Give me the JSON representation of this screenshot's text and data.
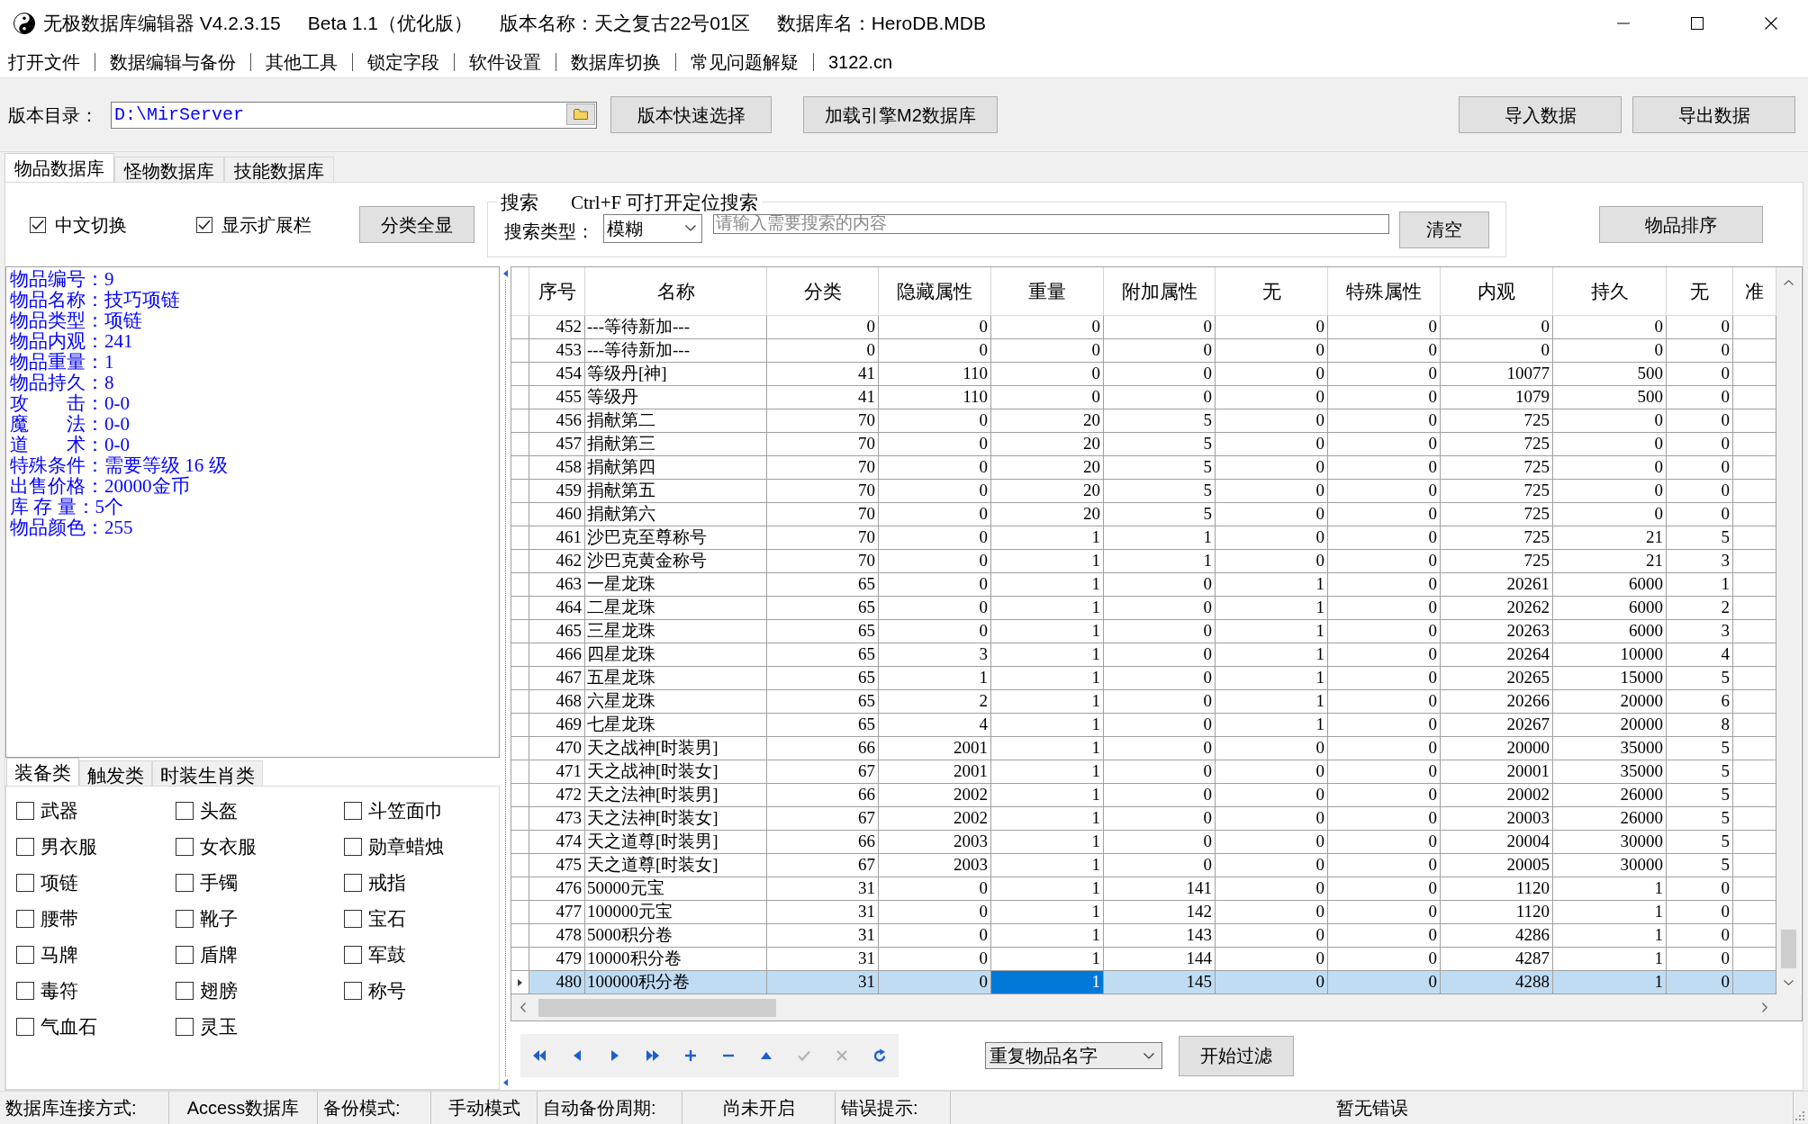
{
  "window": {
    "title_parts": [
      "无极数据库编辑器 V4.2.3.15",
      "Beta 1.1（优化版）",
      "版本名称：天之复古22号01区",
      "数据库名：HeroDB.MDB"
    ]
  },
  "menu": [
    "打开文件",
    "数据编辑与备份",
    "其他工具",
    "锁定字段",
    "软件设置",
    "数据库切换",
    "常见问题解疑",
    "3122.cn"
  ],
  "toolbar": {
    "path_label": "版本目录：",
    "path_value": "D:\\MirServer",
    "buttons": [
      "版本快速选择",
      "加载引擎M2数据库"
    ],
    "data_buttons": [
      "导入数据",
      "导出数据"
    ]
  },
  "tabs": [
    {
      "label": "物品数据库",
      "selected": true
    },
    {
      "label": "怪物数据库",
      "selected": false
    },
    {
      "label": "技能数据库",
      "selected": false
    }
  ],
  "options": {
    "checkboxes": [
      {
        "label": "中文切换",
        "checked": true
      },
      {
        "label": "显示扩展栏",
        "checked": true
      }
    ],
    "show_all_button": "分类全显"
  },
  "search": {
    "title": "搜索",
    "hint": "Ctrl+F 可打开定位搜索",
    "type_label": "搜索类型：",
    "type_value": "模糊",
    "placeholder": "请输入需要搜索的内容",
    "clear_button": "清空"
  },
  "sort_button": "物品排序",
  "item_info": [
    "物品编号：9",
    "物品名称：技巧项链",
    "物品类型：项链",
    "物品内观：241",
    "物品重量：1",
    "物品持久：8",
    "攻　　击：0-0",
    "魔　　法：0-0",
    "道　　术：0-0",
    "特殊条件：需要等级 16 级",
    "出售价格：20000金币",
    "库 存 量：5个",
    "物品颜色：255"
  ],
  "category_tabs": [
    {
      "label": "装备类",
      "selected": true
    },
    {
      "label": "触发类",
      "selected": false
    },
    {
      "label": "时装生肖类",
      "selected": false
    }
  ],
  "categories": [
    {
      "label": "武器",
      "checked": false
    },
    {
      "label": "头盔",
      "checked": false
    },
    {
      "label": "斗笠面巾",
      "checked": false
    },
    {
      "label": "男衣服",
      "checked": false
    },
    {
      "label": "女衣服",
      "checked": false
    },
    {
      "label": "勋章蜡烛",
      "checked": false
    },
    {
      "label": "项链",
      "checked": false
    },
    {
      "label": "手镯",
      "checked": false
    },
    {
      "label": "戒指",
      "checked": false
    },
    {
      "label": "腰带",
      "checked": false
    },
    {
      "label": "靴子",
      "checked": false
    },
    {
      "label": "宝石",
      "checked": false
    },
    {
      "label": "马牌",
      "checked": false
    },
    {
      "label": "盾牌",
      "checked": false
    },
    {
      "label": "军鼓",
      "checked": false
    },
    {
      "label": "毒符",
      "checked": false
    },
    {
      "label": "翅膀",
      "checked": false
    },
    {
      "label": "称号",
      "checked": false
    },
    {
      "label": "气血石",
      "checked": false
    },
    {
      "label": "灵玉",
      "checked": false
    }
  ],
  "table": {
    "columns": [
      {
        "label": "序号",
        "kind": "number",
        "focused": false
      },
      {
        "label": "名称",
        "kind": "text",
        "focused": false
      },
      {
        "label": "分类",
        "kind": "number",
        "focused": false
      },
      {
        "label": "隐藏属性",
        "kind": "number",
        "focused": false
      },
      {
        "label": "重量",
        "kind": "number",
        "focused": true
      },
      {
        "label": "附加属性",
        "kind": "number",
        "focused": false
      },
      {
        "label": "无",
        "kind": "number",
        "focused": false
      },
      {
        "label": "特殊属性",
        "kind": "number",
        "focused": false
      },
      {
        "label": "内观",
        "kind": "number",
        "focused": false
      },
      {
        "label": "持久",
        "kind": "number",
        "focused": false
      },
      {
        "label": "无",
        "kind": "number",
        "focused": false
      },
      {
        "label": "准",
        "kind": "number",
        "focused": false
      }
    ],
    "rows": [
      {
        "cells": [
          "452",
          "---等待新加---",
          "0",
          "0",
          "0",
          "0",
          "0",
          "0",
          "0",
          "0",
          "0"
        ],
        "selected": false
      },
      {
        "cells": [
          "453",
          "---等待新加---",
          "0",
          "0",
          "0",
          "0",
          "0",
          "0",
          "0",
          "0",
          "0"
        ],
        "selected": false
      },
      {
        "cells": [
          "454",
          "等级丹[神]",
          "41",
          "110",
          "0",
          "0",
          "0",
          "0",
          "10077",
          "500",
          "0"
        ],
        "selected": false
      },
      {
        "cells": [
          "455",
          "等级丹",
          "41",
          "110",
          "0",
          "0",
          "0",
          "0",
          "1079",
          "500",
          "0"
        ],
        "selected": false
      },
      {
        "cells": [
          "456",
          "捐献第二",
          "70",
          "0",
          "20",
          "5",
          "0",
          "0",
          "725",
          "0",
          "0"
        ],
        "selected": false
      },
      {
        "cells": [
          "457",
          "捐献第三",
          "70",
          "0",
          "20",
          "5",
          "0",
          "0",
          "725",
          "0",
          "0"
        ],
        "selected": false
      },
      {
        "cells": [
          "458",
          "捐献第四",
          "70",
          "0",
          "20",
          "5",
          "0",
          "0",
          "725",
          "0",
          "0"
        ],
        "selected": false
      },
      {
        "cells": [
          "459",
          "捐献第五",
          "70",
          "0",
          "20",
          "5",
          "0",
          "0",
          "725",
          "0",
          "0"
        ],
        "selected": false
      },
      {
        "cells": [
          "460",
          "捐献第六",
          "70",
          "0",
          "20",
          "5",
          "0",
          "0",
          "725",
          "0",
          "0"
        ],
        "selected": false
      },
      {
        "cells": [
          "461",
          "沙巴克至尊称号",
          "70",
          "0",
          "1",
          "1",
          "0",
          "0",
          "725",
          "21",
          "5"
        ],
        "selected": false
      },
      {
        "cells": [
          "462",
          "沙巴克黄金称号",
          "70",
          "0",
          "1",
          "1",
          "0",
          "0",
          "725",
          "21",
          "3"
        ],
        "selected": false
      },
      {
        "cells": [
          "463",
          "一星龙珠",
          "65",
          "0",
          "1",
          "0",
          "1",
          "0",
          "20261",
          "6000",
          "1"
        ],
        "selected": false
      },
      {
        "cells": [
          "464",
          "二星龙珠",
          "65",
          "0",
          "1",
          "0",
          "1",
          "0",
          "20262",
          "6000",
          "2"
        ],
        "selected": false
      },
      {
        "cells": [
          "465",
          "三星龙珠",
          "65",
          "0",
          "1",
          "0",
          "1",
          "0",
          "20263",
          "6000",
          "3"
        ],
        "selected": false
      },
      {
        "cells": [
          "466",
          "四星龙珠",
          "65",
          "3",
          "1",
          "0",
          "1",
          "0",
          "20264",
          "10000",
          "4"
        ],
        "selected": false
      },
      {
        "cells": [
          "467",
          "五星龙珠",
          "65",
          "1",
          "1",
          "0",
          "1",
          "0",
          "20265",
          "15000",
          "5"
        ],
        "selected": false
      },
      {
        "cells": [
          "468",
          "六星龙珠",
          "65",
          "2",
          "1",
          "0",
          "1",
          "0",
          "20266",
          "20000",
          "6"
        ],
        "selected": false
      },
      {
        "cells": [
          "469",
          "七星龙珠",
          "65",
          "4",
          "1",
          "0",
          "1",
          "0",
          "20267",
          "20000",
          "8"
        ],
        "selected": false
      },
      {
        "cells": [
          "470",
          "天之战神[时装男]",
          "66",
          "2001",
          "1",
          "0",
          "0",
          "0",
          "20000",
          "35000",
          "5"
        ],
        "selected": false
      },
      {
        "cells": [
          "471",
          "天之战神[时装女]",
          "67",
          "2001",
          "1",
          "0",
          "0",
          "0",
          "20001",
          "35000",
          "5"
        ],
        "selected": false
      },
      {
        "cells": [
          "472",
          "天之法神[时装男]",
          "66",
          "2002",
          "1",
          "0",
          "0",
          "0",
          "20002",
          "26000",
          "5"
        ],
        "selected": false
      },
      {
        "cells": [
          "473",
          "天之法神[时装女]",
          "67",
          "2002",
          "1",
          "0",
          "0",
          "0",
          "20003",
          "26000",
          "5"
        ],
        "selected": false
      },
      {
        "cells": [
          "474",
          "天之道尊[时装男]",
          "66",
          "2003",
          "1",
          "0",
          "0",
          "0",
          "20004",
          "30000",
          "5"
        ],
        "selected": false
      },
      {
        "cells": [
          "475",
          "天之道尊[时装女]",
          "67",
          "2003",
          "1",
          "0",
          "0",
          "0",
          "20005",
          "30000",
          "5"
        ],
        "selected": false
      },
      {
        "cells": [
          "476",
          "50000元宝",
          "31",
          "0",
          "1",
          "141",
          "0",
          "0",
          "1120",
          "1",
          "0"
        ],
        "selected": false
      },
      {
        "cells": [
          "477",
          "100000元宝",
          "31",
          "0",
          "1",
          "142",
          "0",
          "0",
          "1120",
          "1",
          "0"
        ],
        "selected": false
      },
      {
        "cells": [
          "478",
          "5000积分卷",
          "31",
          "0",
          "1",
          "143",
          "0",
          "0",
          "4286",
          "1",
          "0"
        ],
        "selected": false
      },
      {
        "cells": [
          "479",
          "10000积分卷",
          "31",
          "0",
          "1",
          "144",
          "0",
          "0",
          "4287",
          "1",
          "0"
        ],
        "selected": false
      },
      {
        "cells": [
          "480",
          "100000积分卷",
          "31",
          "0",
          "1",
          "145",
          "0",
          "0",
          "4288",
          "1",
          "0"
        ],
        "selected": true
      }
    ]
  },
  "navigator": [
    {
      "kind": "first",
      "disabled": false
    },
    {
      "kind": "prior",
      "disabled": false
    },
    {
      "kind": "next",
      "disabled": false
    },
    {
      "kind": "last",
      "disabled": false
    },
    {
      "kind": "insert",
      "disabled": false
    },
    {
      "kind": "delete",
      "disabled": false
    },
    {
      "kind": "edit",
      "disabled": false
    },
    {
      "kind": "post",
      "disabled": true
    },
    {
      "kind": "cancel",
      "disabled": true
    },
    {
      "kind": "refresh",
      "disabled": false
    }
  ],
  "filter": {
    "mode": "重复物品名字",
    "button": "开始过滤"
  },
  "status_bar": [
    {
      "text": "数据库连接方式:",
      "kind": "label"
    },
    {
      "text": "Access数据库",
      "kind": "value"
    },
    {
      "text": "备份模式:",
      "kind": "label"
    },
    {
      "text": "手动模式",
      "kind": "value"
    },
    {
      "text": "自动备份周期:",
      "kind": "label"
    },
    {
      "text": "尚未开启",
      "kind": "value"
    },
    {
      "text": "错误提示:",
      "kind": "label"
    },
    {
      "text": "暂无错误",
      "kind": "value"
    }
  ]
}
